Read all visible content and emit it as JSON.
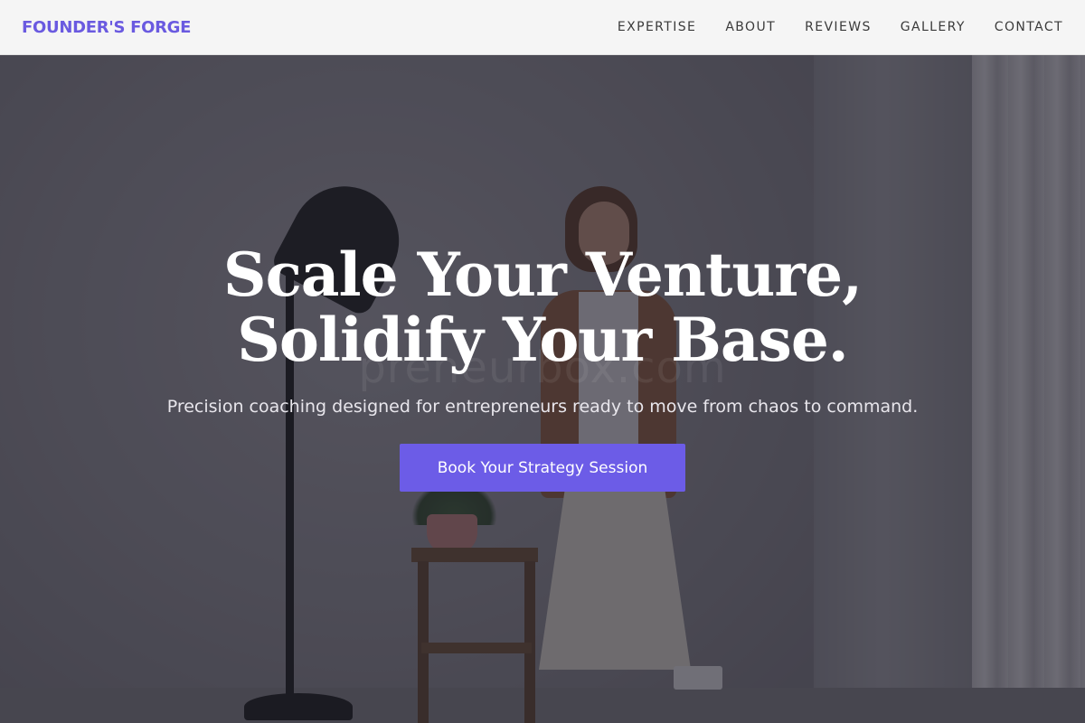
{
  "header": {
    "logo": "FOUNDER'S FORGE",
    "nav": [
      {
        "label": "EXPERTISE"
      },
      {
        "label": "ABOUT"
      },
      {
        "label": "REVIEWS"
      },
      {
        "label": "GALLERY"
      },
      {
        "label": "CONTACT"
      }
    ]
  },
  "hero": {
    "title_line1": "Scale Your Venture,",
    "title_line2": "Solidify Your Base.",
    "subtitle": "Precision coaching designed for entrepreneurs ready to move from chaos to command.",
    "cta_label": "Book Your Strategy Session",
    "watermark": "preneurbox.com"
  },
  "colors": {
    "accent": "#6c5ce7",
    "logo": "#6a5ae0",
    "header_bg": "#f5f5f5"
  }
}
